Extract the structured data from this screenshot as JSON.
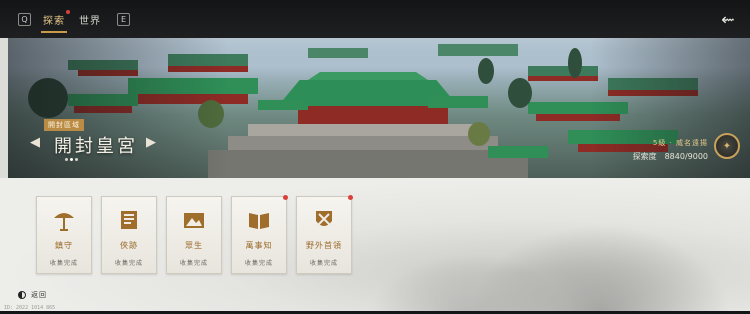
{
  "topbar": {
    "left_key": "Q",
    "tabs": [
      {
        "label": "探索",
        "active": true,
        "has_dot": true
      },
      {
        "label": "世界",
        "active": false,
        "has_dot": false
      }
    ],
    "right_key": "E",
    "back_icon": "back-arrow-icon"
  },
  "banner": {
    "region_tag": "開封區域",
    "place_name": "開封皇宮",
    "pages_total": 3,
    "page_active": 1,
    "explore_tier": "5級 · 威名遠揚",
    "explore_label": "探索度",
    "explore_value": "8840/9000",
    "compass_icon": "compass-icon"
  },
  "cards": [
    {
      "title": "鎮守",
      "status": "收集完成",
      "icon": "umbrella-icon",
      "badge": false
    },
    {
      "title": "俠跡",
      "status": "收集完成",
      "icon": "scroll-book-icon",
      "badge": false
    },
    {
      "title": "眾生",
      "status": "收集完成",
      "icon": "landscape-painting-icon",
      "badge": false
    },
    {
      "title": "萬事知",
      "status": "收集完成",
      "icon": "open-book-icon",
      "badge": true
    },
    {
      "title": "野外首領",
      "status": "收集完成",
      "icon": "crossed-swords-shield-icon",
      "badge": true
    }
  ],
  "footer": {
    "toggle_label": "返回",
    "uid": "ID: 2022 1014 865"
  },
  "colors": {
    "accent_gold": "#b98b45",
    "notify_red": "#d9413a",
    "card_title": "#9b6b2a"
  }
}
